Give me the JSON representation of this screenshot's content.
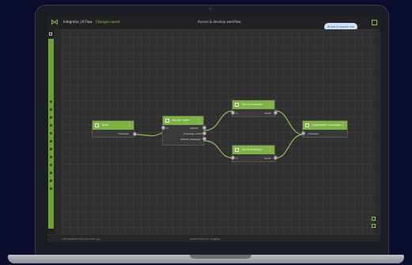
{
  "app": {
    "project_name": "Integrator_UI Flow",
    "status": "Changes saved",
    "window_title": "Access & develop workflow",
    "share_label": "Share & export link"
  },
  "status_bar": {
    "left": "Last updated a few seconds ago",
    "middle": "Select nodes by dragging"
  },
  "nodes": {
    "start": {
      "title": "Start",
      "out_label": "message"
    },
    "router": {
      "title": "Router node",
      "in_label": "in",
      "outs": [
        "default",
        "message_matched",
        "default_message"
      ]
    },
    "top": {
      "title": "Send message",
      "in_label": "in",
      "out_label": "result"
    },
    "bottom": {
      "title": "Send message",
      "in_label": "in",
      "out_label": "result"
    },
    "end": {
      "title": "Aggregate messages",
      "out_label": "message"
    }
  },
  "colors": {
    "accent": "#7cb342",
    "canvas": "#303030",
    "share_button": "#cfe3f7"
  }
}
